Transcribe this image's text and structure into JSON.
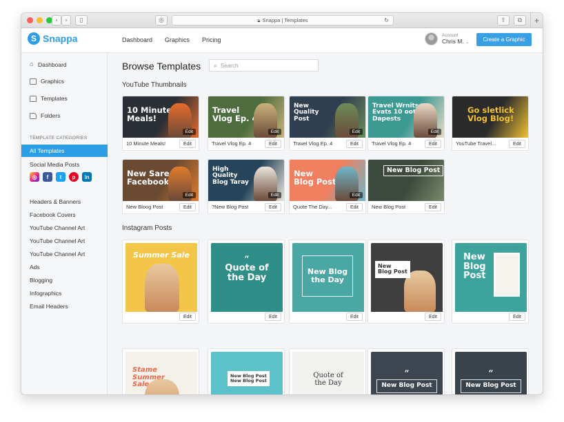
{
  "browser": {
    "url_text": "Snappa | Templates",
    "new_tab": "+"
  },
  "app": {
    "logo_letter": "S",
    "logo_text": "Snappa"
  },
  "topnav": {
    "links": [
      "Dashboard",
      "Graphics",
      "Pricing"
    ],
    "account_label": "Account",
    "account_name": "Chris M.",
    "create_button": "Create a Graphic"
  },
  "sidebar": {
    "main": [
      "Dashboard",
      "Graphics",
      "Templates",
      "Folders"
    ],
    "categories_title": "TEMPLATE CATEGORIES",
    "active": "All Templates",
    "social_media": "Social Media Posts",
    "social_icons": [
      "instagram-icon",
      "facebook-icon",
      "twitter-icon",
      "pinterest-icon",
      "linkedin-icon"
    ],
    "categories": [
      "Headers & Banners",
      "Facebook Covers",
      "YouTube Channel Art",
      "YouTube Channel Art",
      "YouTube Channel Art",
      "Ads",
      "Blogging",
      "Infographics",
      "Email Headers"
    ]
  },
  "main": {
    "title": "Browse Templates",
    "search_placeholder": "Search",
    "sections": [
      "YouTube Thumbnails",
      "Instagram Posts"
    ],
    "edit_label": "Edit"
  },
  "youtube": [
    {
      "label": "10 Minute Meals!",
      "art": "10 Minute\nMeals!",
      "bg": "#2a2f36",
      "accent": "#e56b2c"
    },
    {
      "label": "Travel Vlog Ep. 4",
      "art": "Travel\nVlog Ep. 4",
      "bg": "#4d6d3e",
      "accent": "#c9b27a"
    },
    {
      "label": "Travel Vlog Ep. 4",
      "art": "New\nQuality\nPost",
      "bg": "#2f3f4f",
      "accent": "#6c8c5a"
    },
    {
      "label": "Travel Vlog Ep. 4",
      "art": "Travel Wrnits\nEvats 10 oot\nDapests",
      "bg": "#3c9a93",
      "accent": "#e9d9c3"
    },
    {
      "label": "YouTube Travel...",
      "art": "Go sletlick\nVlog Blog!",
      "bg": "#2b2b2b",
      "accent": "#f1c232"
    },
    {
      "label": "New Bloog Post",
      "art": "New Sare By\nFacebook t",
      "bg": "#6a4a33",
      "accent": "#e07b2c"
    },
    {
      "label": "?New Blog Post",
      "art": "High\nQuality\nBlog Taray",
      "bg": "#26445a",
      "accent": "#e9e4da"
    },
    {
      "label": "Quote The Day...",
      "art": "New\nBlog Post",
      "bg": "#ef7f5f",
      "accent": "#6fb6c9"
    },
    {
      "label": "New Blog Post",
      "art": "New Blog Post",
      "bg": "#3b4a3c",
      "accent": "#7a8a6a"
    }
  ],
  "instagram": [
    {
      "art": "Summer Sale",
      "bg": "#f3c64a",
      "accent": "#7fc7d9"
    },
    {
      "art": "Quote of\nthe Day",
      "bg": "#2f8f88",
      "accent": "#ffffff"
    },
    {
      "art": "New Blog\nthe Day",
      "bg": "#4aa7a3",
      "accent": "#ffffff"
    },
    {
      "art": "New\nBlog Post",
      "bg": "#3f3f3f",
      "accent": "#ffffff"
    },
    {
      "art": "New\nBlog\nPost",
      "bg": "#3ea39c",
      "accent": "#ffffff"
    },
    {
      "art": "Stame\nSummer\nSale",
      "bg": "#f4f0ea",
      "accent": "#e86a4a"
    },
    {
      "art": "New Blog Post\nNew Blog Post",
      "bg": "#5cc2c9",
      "accent": "#f3b5b5"
    },
    {
      "art": "Quote of\nthe Day",
      "bg": "#f1f1ef",
      "accent": "#8fd0cf"
    },
    {
      "art": "New Blog Post",
      "bg": "#3d4650",
      "accent": "#ffffff"
    },
    {
      "art": "New Blog Post",
      "bg": "#39434b",
      "accent": "#ffffff"
    }
  ]
}
